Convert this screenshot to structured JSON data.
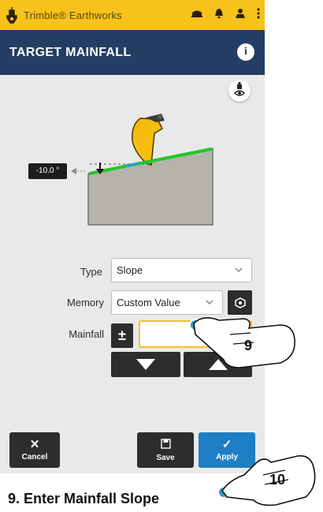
{
  "statusbar": {
    "app_title": "Trimble® Earthworks",
    "icons": [
      "trimble-logo-icon",
      "machine-icon",
      "notification-bell-icon",
      "operator-icon",
      "more-vert-icon"
    ]
  },
  "titlebar": {
    "title": "TARGET MAINFALL",
    "info_glyph": "i"
  },
  "canvas": {
    "slope_value": "-10.0 °",
    "icons": [
      "camera-view-icon",
      "bucket-icon",
      "arrow-left-icon"
    ]
  },
  "form": {
    "type": {
      "label": "Type",
      "value": "Slope"
    },
    "memory": {
      "label": "Memory",
      "value": "Custom Value"
    },
    "mainfall": {
      "label": "Mainfall",
      "value": ""
    },
    "sign_button": "±"
  },
  "buttons": {
    "cancel": "Cancel",
    "save": "Save",
    "apply": "Apply"
  },
  "colors": {
    "status_yellow": "#f6c21b",
    "title_navy": "#243e63",
    "apply_blue": "#1f7fc4",
    "slope_green": "#22c72a",
    "bucket_yellow": "#f4bd10"
  },
  "annotations": {
    "step_9": "9",
    "step_10": "10",
    "caption": "9.  Enter Mainfall Slope"
  }
}
